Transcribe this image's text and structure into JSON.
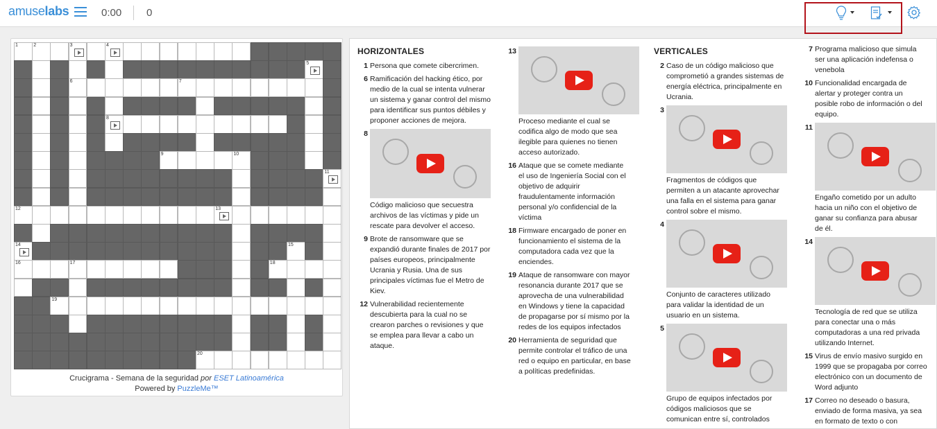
{
  "header": {
    "logo_part1": "amuse",
    "logo_part2": "labs",
    "timer": "0:00",
    "score": "0"
  },
  "board": {
    "caption_title": "Crucigrama - Semana de la seguridad",
    "caption_by": "por",
    "caption_author": "ESET Latinoamérica",
    "powered_by": "Powered by",
    "powered_name": "PuzzleMe™"
  },
  "grid": {
    "rows": 18,
    "cols": 18,
    "pattern": [
      "WWWWWWWWWWWWWBBBBB",
      "BWBWBWBBBBBBBBBBWB",
      "BWBWWWWWWWWWWWWWWB",
      "BWBWBWBBBBWBBBBBWB",
      "BWBWBWWWWWWWWWWBWB",
      "BWBWBWBBBBWBBBBBWB",
      "BWBWBBBBWWWWWBBBWB",
      "BWBWBBBBBBBBWBBBBW",
      "BWBWBBBBBBBBWBBBBW",
      "WWWWWWWWWWWWWWWWWW",
      "BWBBBBBBBBBBWBBBBW",
      "WBBBBBBBBBBBWBBWBW",
      "WWWWWWWWWBBBWBWWWW",
      "WBBWBBBBBBBBWBBWBW",
      "BBWWWWWWWWWWWWWWWW",
      "BBBWBBBBBBBBWBBWBW",
      "BBBBBBBBBBBBWBBWBW",
      "BBBBBBBBBBWWWWWWWW"
    ],
    "numbers": [
      {
        "r": 0,
        "c": 0,
        "n": "1"
      },
      {
        "r": 0,
        "c": 1,
        "n": "2"
      },
      {
        "r": 0,
        "c": 3,
        "n": "3"
      },
      {
        "r": 0,
        "c": 5,
        "n": "4"
      },
      {
        "r": 1,
        "c": 16,
        "n": "5"
      },
      {
        "r": 2,
        "c": 3,
        "n": "6"
      },
      {
        "r": 2,
        "c": 9,
        "n": "7"
      },
      {
        "r": 4,
        "c": 5,
        "n": "8"
      },
      {
        "r": 6,
        "c": 8,
        "n": "9"
      },
      {
        "r": 6,
        "c": 12,
        "n": "10"
      },
      {
        "r": 7,
        "c": 17,
        "n": "11"
      },
      {
        "r": 9,
        "c": 0,
        "n": "12"
      },
      {
        "r": 9,
        "c": 11,
        "n": "13"
      },
      {
        "r": 11,
        "c": 0,
        "n": "14"
      },
      {
        "r": 11,
        "c": 15,
        "n": "15"
      },
      {
        "r": 12,
        "c": 0,
        "n": "16"
      },
      {
        "r": 12,
        "c": 3,
        "n": "17"
      },
      {
        "r": 12,
        "c": 14,
        "n": "18"
      },
      {
        "r": 14,
        "c": 2,
        "n": "19"
      },
      {
        "r": 17,
        "c": 10,
        "n": "20"
      }
    ],
    "films": [
      {
        "r": 0,
        "c": 3
      },
      {
        "r": 0,
        "c": 5
      },
      {
        "r": 1,
        "c": 16
      },
      {
        "r": 4,
        "c": 5
      },
      {
        "r": 7,
        "c": 17
      },
      {
        "r": 9,
        "c": 11
      },
      {
        "r": 11,
        "c": 0
      }
    ]
  },
  "clues": {
    "horizontal_heading": "HORIZONTALES",
    "vertical_heading": "VERTICALES",
    "col1": [
      {
        "n": "1",
        "text": "Persona que comete cibercrimen."
      },
      {
        "n": "6",
        "text": "Ramificación del hacking ético, por medio de la cual se intenta vulnerar un sistema y ganar control del mismo para identificar sus puntos débiles y proponer acciones de mejora."
      },
      {
        "n": "8",
        "text": "Código malicioso que secuestra archivos de las víctimas y pide un rescate para devolver el acceso."
      },
      {
        "n": "9",
        "text": "Brote de ransomware que se expandió durante finales de 2017 por países europeos, principalmente Ucrania y Rusia. Una de sus principales víctimas fue el Metro de Kiev."
      },
      {
        "n": "12",
        "text": "Vulnerabilidad recientemente descubierta para la cual no se crearon parches o revisiones y que se emplea para llevar a cabo un ataque."
      }
    ],
    "col2": [
      {
        "n": "13",
        "text": "Proceso mediante el cual se codifica algo de modo que sea ilegible para quienes no tienen acceso autorizado."
      },
      {
        "n": "16",
        "text": "Ataque que se comete mediante el uso de Ingeniería Social con el objetivo de adquirir fraudulentamente información personal y/o confidencial de la víctima"
      },
      {
        "n": "18",
        "text": "Firmware encargado de poner en funcionamiento el sistema de la computadora cada vez que la enciendes."
      },
      {
        "n": "19",
        "text": "Ataque de ransomware con mayor resonancia durante 2017 que se aprovecha de una vulnerabilidad en Windows y tiene la capacidad de propagarse por sí mismo por la redes de los equipos infectados"
      },
      {
        "n": "20",
        "text": "Herramienta de seguridad que permite controlar el tráfico de una red o equipo en particular, en base a políticas predefinidas."
      }
    ],
    "col3": [
      {
        "n": "2",
        "text": "Caso de un código malicioso que comprometió a grandes sistemas de energía eléctrica, principalmente en Ucrania."
      },
      {
        "n": "3",
        "text": "Fragmentos de códigos que permiten a un atacante aprovechar una falla en el sistema para ganar control sobre el mismo."
      },
      {
        "n": "4",
        "text": "Conjunto de caracteres utilizado para validar la identidad de un usuario en un sistema."
      },
      {
        "n": "5",
        "text": "Grupo de equipos infectados por códigos maliciosos que se comunican entre sí, controlados"
      }
    ],
    "col4": [
      {
        "n": "7",
        "text": "Programa malicioso que simula ser una aplicación indefensa o venebola"
      },
      {
        "n": "10",
        "text": "Funcionalidad encargada de alertar y proteger contra un posible robo de información o del equipo."
      },
      {
        "n": "11",
        "text": "Engaño cometido por un adulto hacia un niño con el objetivo de ganar su confianza para abusar de él."
      },
      {
        "n": "14",
        "text": "Tecnología de red que se utiliza para conectar una o más computadoras a una red privada utilizando Internet."
      },
      {
        "n": "15",
        "text": "Virus de envío masivo surgido en 1999 que se propagaba por correo electrónico con un documento de Word adjunto"
      },
      {
        "n": "17",
        "text": "Correo no deseado o basura, enviado de forma masiva, ya sea en formato de texto o con contenido HTML."
      }
    ]
  },
  "icons": {
    "hint": "lightbulb-icon",
    "check": "checklist-icon",
    "settings": "gear-icon",
    "video": "youtube-play-icon"
  },
  "colors": {
    "brand": "#3a8fd8",
    "highlight_box": "#b3131b",
    "play_button": "#e62117",
    "black_cell": "#666666"
  }
}
